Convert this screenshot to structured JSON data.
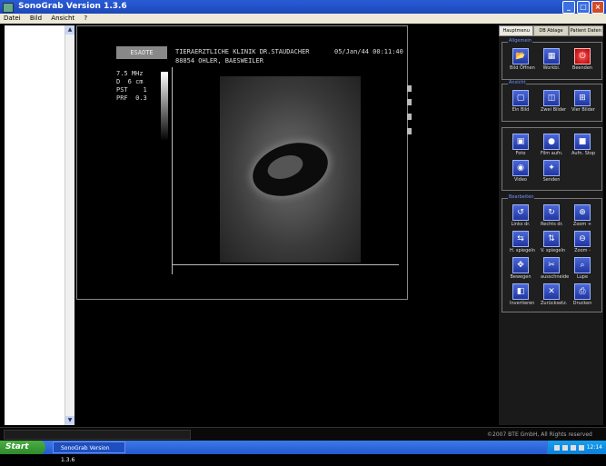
{
  "window": {
    "title": "SonoGrab Version 1.3.6"
  },
  "menu": [
    "Datei",
    "Bild",
    "Ansicht",
    "?"
  ],
  "scan_header": {
    "brand": "ESAOTE",
    "clinic_line1": "TIERAERZTLICHE KLINIK DR.STAUDACHER",
    "clinic_line2": "88854 OHLER, BAESWEILER",
    "datetime": "05/Jan/44 00:11:40",
    "params": [
      "7.5 MHz",
      "D  6 cm",
      "PST    1",
      "PRF  0.3"
    ]
  },
  "tabs": [
    "Hauptmenu",
    "DB Ablage",
    "Patient Daten"
  ],
  "groups": [
    {
      "title": "Allgemein",
      "buttons": [
        {
          "label": "Bild Öffnen",
          "icon": "folder-open-icon",
          "glyph": "📂"
        },
        {
          "label": "Workbl.",
          "icon": "grid-icon",
          "glyph": "▦"
        },
        {
          "label": "Beenden",
          "icon": "power-icon",
          "glyph": "⏻",
          "red": true
        }
      ]
    },
    {
      "title": "Ansicht",
      "buttons": [
        {
          "label": "Ein Bild",
          "icon": "single-view-icon",
          "glyph": "▢"
        },
        {
          "label": "Zwei Bilder",
          "icon": "dual-view-icon",
          "glyph": "◫"
        },
        {
          "label": "Vier Bilder",
          "icon": "quad-view-icon",
          "glyph": "⊞"
        }
      ]
    },
    {
      "title": "",
      "buttons": [
        {
          "label": "Foto",
          "icon": "camera-icon",
          "glyph": "▣"
        },
        {
          "label": "Film aufn.",
          "icon": "record-icon",
          "glyph": "●"
        },
        {
          "label": "Aufn. Stop",
          "icon": "stop-icon",
          "glyph": "■"
        },
        {
          "label": "Video",
          "icon": "video-icon",
          "glyph": "◉"
        },
        {
          "label": "Senden",
          "icon": "send-icon",
          "glyph": "✦"
        }
      ]
    },
    {
      "title": "Bearbeiten",
      "buttons": [
        {
          "label": "Links dr.",
          "icon": "rotate-left-icon",
          "glyph": "↺"
        },
        {
          "label": "Rechts dr.",
          "icon": "rotate-right-icon",
          "glyph": "↻"
        },
        {
          "label": "Zoom +",
          "icon": "zoom-in-icon",
          "glyph": "⊕"
        },
        {
          "label": "H. spiegeln",
          "icon": "mirror-h-icon",
          "glyph": "⇆"
        },
        {
          "label": "V. spiegeln",
          "icon": "mirror-v-icon",
          "glyph": "⇅"
        },
        {
          "label": "Zoom -",
          "icon": "zoom-out-icon",
          "glyph": "⊖"
        },
        {
          "label": "Bewegen",
          "icon": "move-icon",
          "glyph": "✥"
        },
        {
          "label": "ausschneide",
          "icon": "scissors-icon",
          "glyph": "✂"
        },
        {
          "label": "Lupe",
          "icon": "magnifier-icon",
          "glyph": "⌕"
        },
        {
          "label": "Invertieren",
          "icon": "invert-icon",
          "glyph": "◧"
        },
        {
          "label": "Zurücksetz.",
          "icon": "reset-icon",
          "glyph": "✕"
        },
        {
          "label": "Drucken",
          "icon": "print-icon",
          "glyph": "⎙"
        }
      ]
    }
  ],
  "copyright": "©2007 BTE GmbH, All Rights reserved",
  "taskbar": {
    "start": "Start",
    "task": "SonoGrab Version 1.3.6",
    "clock": "12:14"
  }
}
